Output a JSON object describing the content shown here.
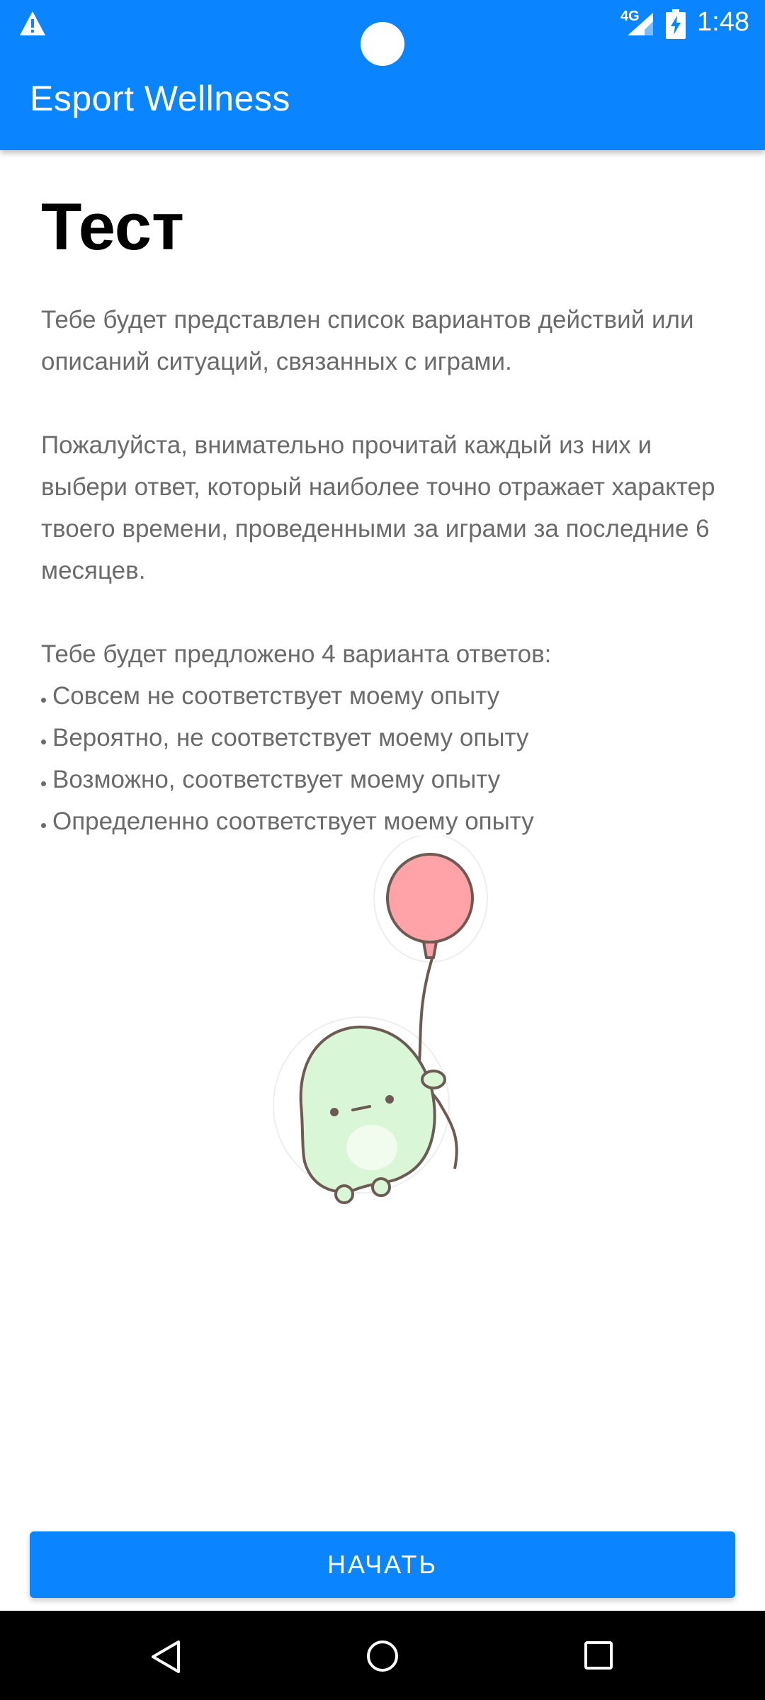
{
  "status_bar": {
    "time": "1:48",
    "network": "4G",
    "icons": [
      "warning-icon",
      "signal-icon",
      "battery-charging-icon"
    ]
  },
  "app_bar": {
    "title": "Esport Wellness"
  },
  "main": {
    "title": "Тест",
    "paragraph1": "Тебе будет представлен список вариантов действий или описаний ситуаций, связанных с играми.",
    "paragraph2": "Пожалуйста, внимательно прочитай каждый из них и выбери ответ, который наиболее точно отражает характер твоего времени, проведенными за играми за последние 6 месяцев.",
    "paragraph3": "Тебе будет предложено 4 варианта ответов:",
    "options": [
      "Совсем не соответствует моему опыту",
      "Вероятно, не соответствует моему опыту",
      "Возможно, соответствует моему опыту",
      "Определенно соответствует моему опыту"
    ]
  },
  "illustration": {
    "icon": "creature-with-balloon-sticker",
    "balloon_color": "#ffa3a8",
    "body_color": "#d9f7d6"
  },
  "actions": {
    "start_label": "НАЧАТЬ"
  },
  "nav_bar": {
    "icons": [
      "back-icon",
      "home-icon",
      "recents-icon"
    ]
  },
  "colors": {
    "accent": "#0a84ff",
    "body_text": "#6b6b6b"
  }
}
